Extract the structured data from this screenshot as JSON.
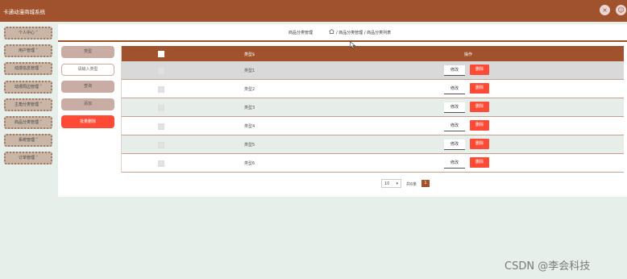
{
  "app": {
    "title": "卡通动漫商城系统"
  },
  "topbar": {
    "icon_close": "×",
    "icon_user": "☺"
  },
  "sidebar": {
    "items": [
      {
        "label": "个人中心 ˅"
      },
      {
        "label": "用户管理 ˅"
      },
      {
        "label": "动漫信息管理 ˅"
      },
      {
        "label": "动漫周边管理 ˅"
      },
      {
        "label": "主角分类管理 ˅"
      },
      {
        "label": "商品分类管理 ˅"
      },
      {
        "label": "系统管理 ˅"
      },
      {
        "label": "订单管理 ˅"
      }
    ]
  },
  "breadcrumb": {
    "title": "商品分类管理",
    "path": "/ 商品分类管理 / 商品分类列表"
  },
  "filter": {
    "type_label": "类型",
    "input_placeholder": "请输入类型",
    "query_label": "查询",
    "add_label": "添加",
    "batch_delete_label": "批量删除"
  },
  "table": {
    "headers": {
      "name": "类型$",
      "ops": "操作"
    },
    "edit_label": "修改",
    "delete_label": "删除",
    "rows": [
      {
        "name": "类型1"
      },
      {
        "name": "类型2"
      },
      {
        "name": "类型3"
      },
      {
        "name": "类型4"
      },
      {
        "name": "类型5"
      },
      {
        "name": "类型6"
      }
    ]
  },
  "pager": {
    "page_size": "10",
    "total": "共6条",
    "current_page": "1"
  },
  "watermark": "CSDN @李会科技",
  "colors": {
    "brand": "#a0522d",
    "danger": "#ff4a35",
    "background": "#e6efea"
  }
}
